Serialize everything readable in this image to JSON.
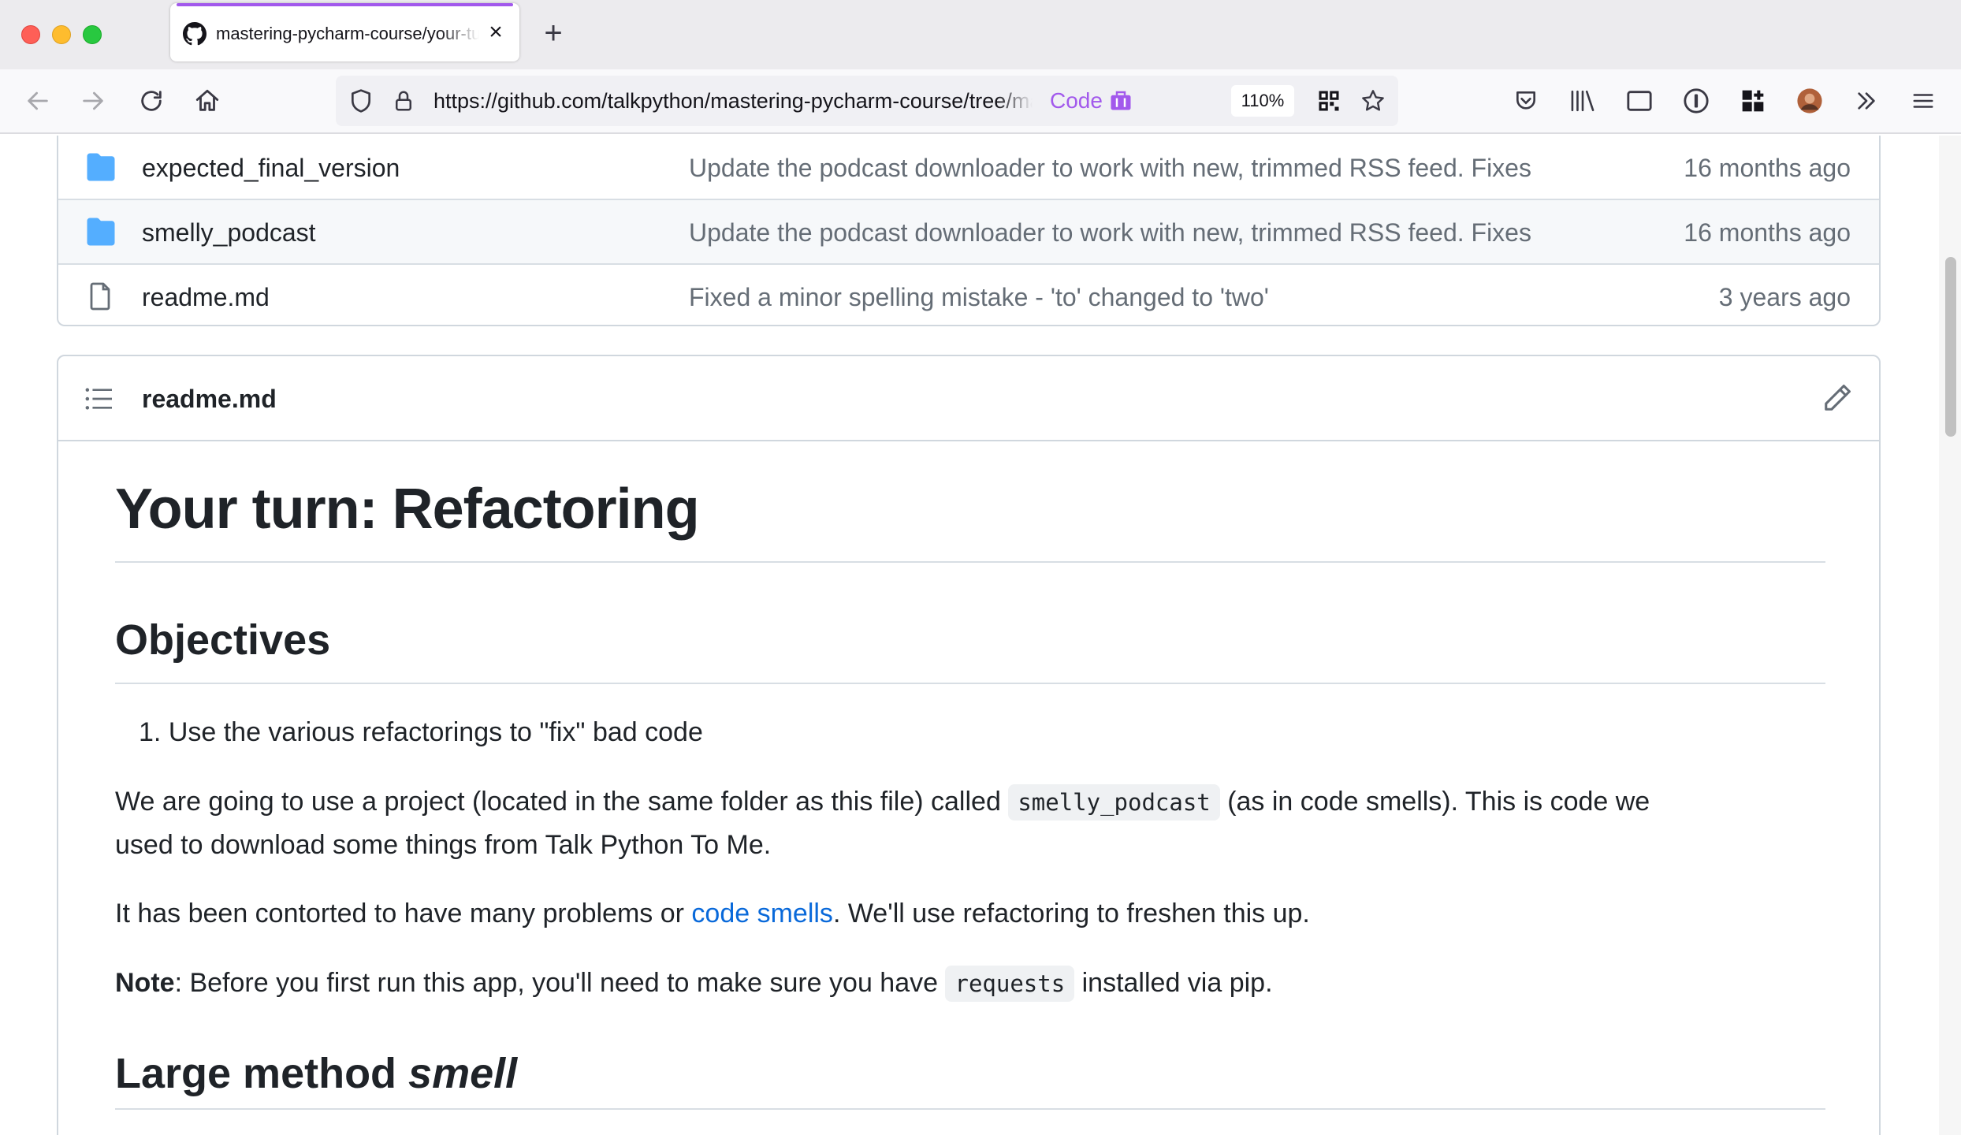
{
  "browser": {
    "tab_title": "mastering-pycharm-course/your-turn at main · talkpython/mastering-pycharm-course",
    "url": "https://github.com/talkpython/mastering-pycharm-course/tree/main/your-turn",
    "code_badge": "Code",
    "zoom": "110%",
    "accent_color": "#a259ec"
  },
  "files": [
    {
      "icon": "folder-icon",
      "name": "expected_final_version",
      "message": "Update the podcast downloader to work with new, trimmed RSS feed. Fixes",
      "age": "16 months ago"
    },
    {
      "icon": "folder-icon",
      "name": "smelly_podcast",
      "message": "Update the podcast downloader to work with new, trimmed RSS feed. Fixes",
      "age": "16 months ago"
    },
    {
      "icon": "file-icon",
      "name": "readme.md",
      "message": "Fixed a minor spelling mistake - 'to' changed to 'two'",
      "age": "3 years ago"
    }
  ],
  "readme": {
    "filename": "readme.md",
    "title": "Your turn: Refactoring",
    "objectives_heading": "Objectives",
    "objective_number": "1.",
    "objective_1": "Use the various refactorings to \"fix\" bad code",
    "p1_before": "We are going to use a project (located in the same folder as this file) called ",
    "p1_code": "smelly_podcast",
    "p1_after_line1": " (as in code smells). This is code we",
    "p1_line2": "used to download some things from Talk Python To Me.",
    "p2_before": "It has been contorted to have many problems or ",
    "p2_link": "code smells",
    "p2_after": ". We'll use refactoring to freshen this up.",
    "p3_bold": "Note",
    "p3_before": ": Before you first run this app, you'll need to make sure you have ",
    "p3_code": "requests",
    "p3_after": " installed via pip.",
    "section_heading": "Large method ",
    "section_heading_em": "smell"
  }
}
